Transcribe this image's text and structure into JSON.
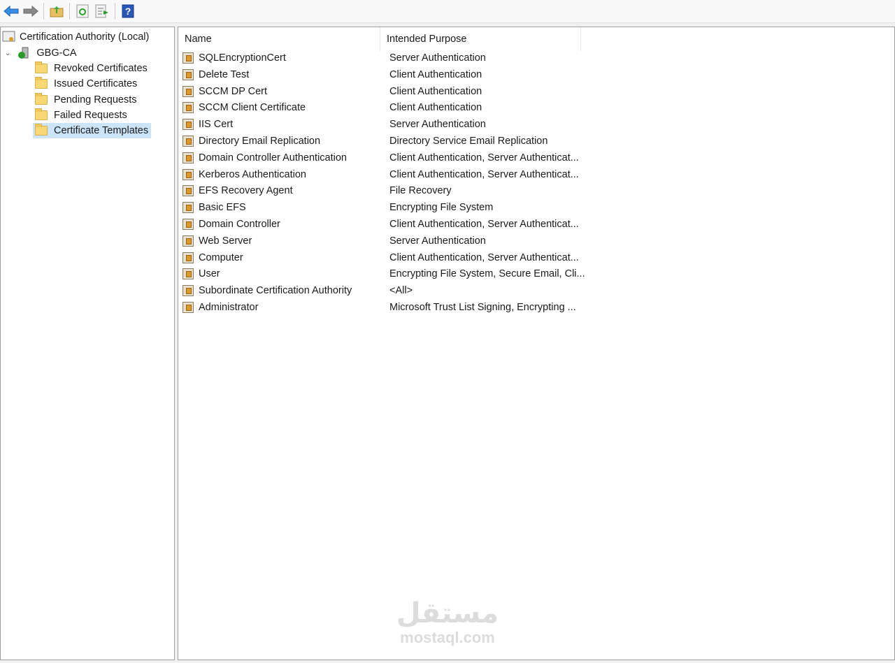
{
  "toolbar": {
    "buttons": [
      "back",
      "forward",
      "up-one-level",
      "refresh",
      "export-list",
      "help"
    ]
  },
  "tree": {
    "root": "Certification Authority (Local)",
    "ca": "GBG-CA",
    "children": [
      "Revoked Certificates",
      "Issued Certificates",
      "Pending Requests",
      "Failed Requests",
      "Certificate Templates"
    ],
    "selected": "Certificate Templates"
  },
  "list": {
    "columns": [
      "Name",
      "Intended Purpose"
    ],
    "rows": [
      {
        "name": "SQLEncryptionCert",
        "purpose": "Server Authentication"
      },
      {
        "name": "Delete Test",
        "purpose": "Client Authentication"
      },
      {
        "name": "SCCM DP Cert",
        "purpose": "Client Authentication"
      },
      {
        "name": "SCCM Client Certificate",
        "purpose": "Client Authentication"
      },
      {
        "name": "IIS Cert",
        "purpose": "Server Authentication"
      },
      {
        "name": "Directory Email Replication",
        "purpose": "Directory Service Email Replication"
      },
      {
        "name": "Domain Controller Authentication",
        "purpose": "Client Authentication, Server Authenticat..."
      },
      {
        "name": "Kerberos Authentication",
        "purpose": "Client Authentication, Server Authenticat..."
      },
      {
        "name": "EFS Recovery Agent",
        "purpose": "File Recovery"
      },
      {
        "name": "Basic EFS",
        "purpose": "Encrypting File System"
      },
      {
        "name": "Domain Controller",
        "purpose": "Client Authentication, Server Authenticat..."
      },
      {
        "name": "Web Server",
        "purpose": "Server Authentication"
      },
      {
        "name": "Computer",
        "purpose": "Client Authentication, Server Authenticat..."
      },
      {
        "name": "User",
        "purpose": "Encrypting File System, Secure Email, Cli..."
      },
      {
        "name": "Subordinate Certification Authority",
        "purpose": "<All>"
      },
      {
        "name": "Administrator",
        "purpose": "Microsoft Trust List Signing, Encrypting ..."
      }
    ]
  },
  "watermark": {
    "arabic": "مستقل",
    "latin": "mostaql.com"
  }
}
